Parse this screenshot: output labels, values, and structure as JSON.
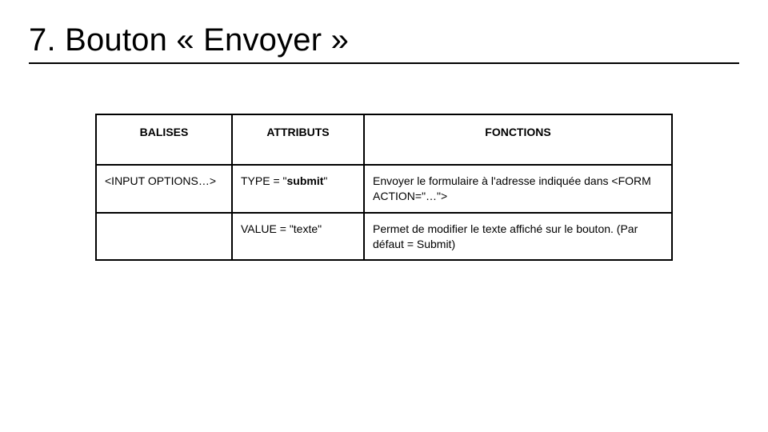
{
  "title": "7. Bouton « Envoyer »",
  "table": {
    "headers": {
      "balises": "BALISES",
      "attributs": "ATTRIBUTS",
      "fonctions": "FONCTIONS"
    },
    "rows": [
      {
        "balises": "<INPUT OPTIONS…>",
        "attributs_pre": "TYPE = \"",
        "attributs_bold": "submit",
        "attributs_post": "\"",
        "fonctions": "Envoyer le formulaire à l'adresse indiquée dans <FORM ACTION=\"…\">"
      },
      {
        "balises": "",
        "attributs_pre": "VALUE = \"texte\"",
        "attributs_bold": "",
        "attributs_post": "",
        "fonctions": "Permet de modifier le texte affiché sur le bouton. (Par défaut = Submit)"
      }
    ]
  }
}
